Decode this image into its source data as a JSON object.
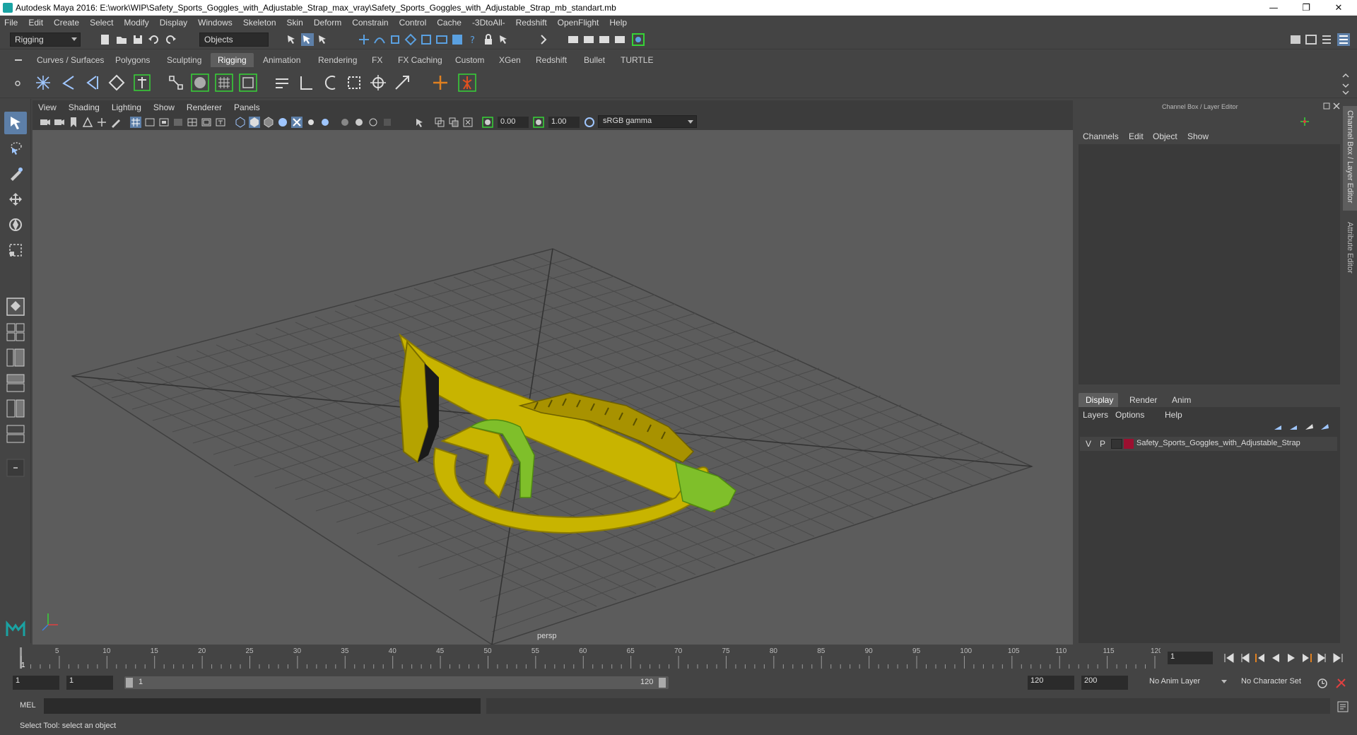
{
  "window": {
    "title": "Autodesk Maya 2016: E:\\work\\WIP\\Safety_Sports_Goggles_with_Adjustable_Strap_max_vray\\Safety_Sports_Goggles_with_Adjustable_Strap_mb_standart.mb",
    "minimize": "—",
    "restore": "❐",
    "close": "✕"
  },
  "menubar": [
    "File",
    "Edit",
    "Create",
    "Select",
    "Modify",
    "Display",
    "Windows",
    "Skeleton",
    "Skin",
    "Deform",
    "Constrain",
    "Control",
    "Cache",
    "-3DtoAll-",
    "Redshift",
    "OpenFlight",
    "Help"
  ],
  "statusline": {
    "menuset": "Rigging",
    "selection_mode": "Objects"
  },
  "shelf_tabs": [
    "Curves / Surfaces",
    "Polygons",
    "Sculpting",
    "Rigging",
    "Animation",
    "Rendering",
    "FX",
    "FX Caching",
    "Custom",
    "XGen",
    "Redshift",
    "Bullet",
    "TURTLE"
  ],
  "active_shelf_tab": "Rigging",
  "viewport": {
    "menu": [
      "View",
      "Shading",
      "Lighting",
      "Show",
      "Renderer",
      "Panels"
    ],
    "exposure": "0.00",
    "gamma": "1.00",
    "color_space": "sRGB gamma",
    "camera_label": "persp"
  },
  "channel_box": {
    "header": "Channel Box / Layer Editor",
    "menu": [
      "Channels",
      "Edit",
      "Object",
      "Show"
    ],
    "layer_tabs": [
      "Display",
      "Render",
      "Anim"
    ],
    "active_layer_tab": "Display",
    "layer_menu": [
      "Layers",
      "Options",
      "Help"
    ],
    "layer": {
      "visible": "V",
      "playback": "P",
      "name": "Safety_Sports_Goggles_with_Adjustable_Strap",
      "color": "#9b1030"
    }
  },
  "side_tabs": [
    "Channel Box / Layer Editor",
    "Attribute Editor"
  ],
  "timeline": {
    "ticks": [
      "1",
      "5",
      "10",
      "15",
      "20",
      "25",
      "30",
      "35",
      "40",
      "45",
      "50",
      "55",
      "60",
      "65",
      "70",
      "75",
      "80",
      "85",
      "90",
      "95",
      "100",
      "105",
      "110",
      "115",
      "120"
    ],
    "current_frame": "1"
  },
  "range": {
    "start": "1",
    "playback_start": "1",
    "slider_start": "1",
    "slider_end": "120",
    "playback_end": "120",
    "end": "200",
    "anim_layer": "No Anim Layer",
    "character_set": "No Character Set"
  },
  "mel": {
    "label": "MEL"
  },
  "helpline": "Select Tool: select an object",
  "colors": {
    "goggle_frame": "#c8b400",
    "goggle_strap": "#7fbf2a",
    "accent_active": "#5d7fa8",
    "highlight_green": "#36d336"
  }
}
